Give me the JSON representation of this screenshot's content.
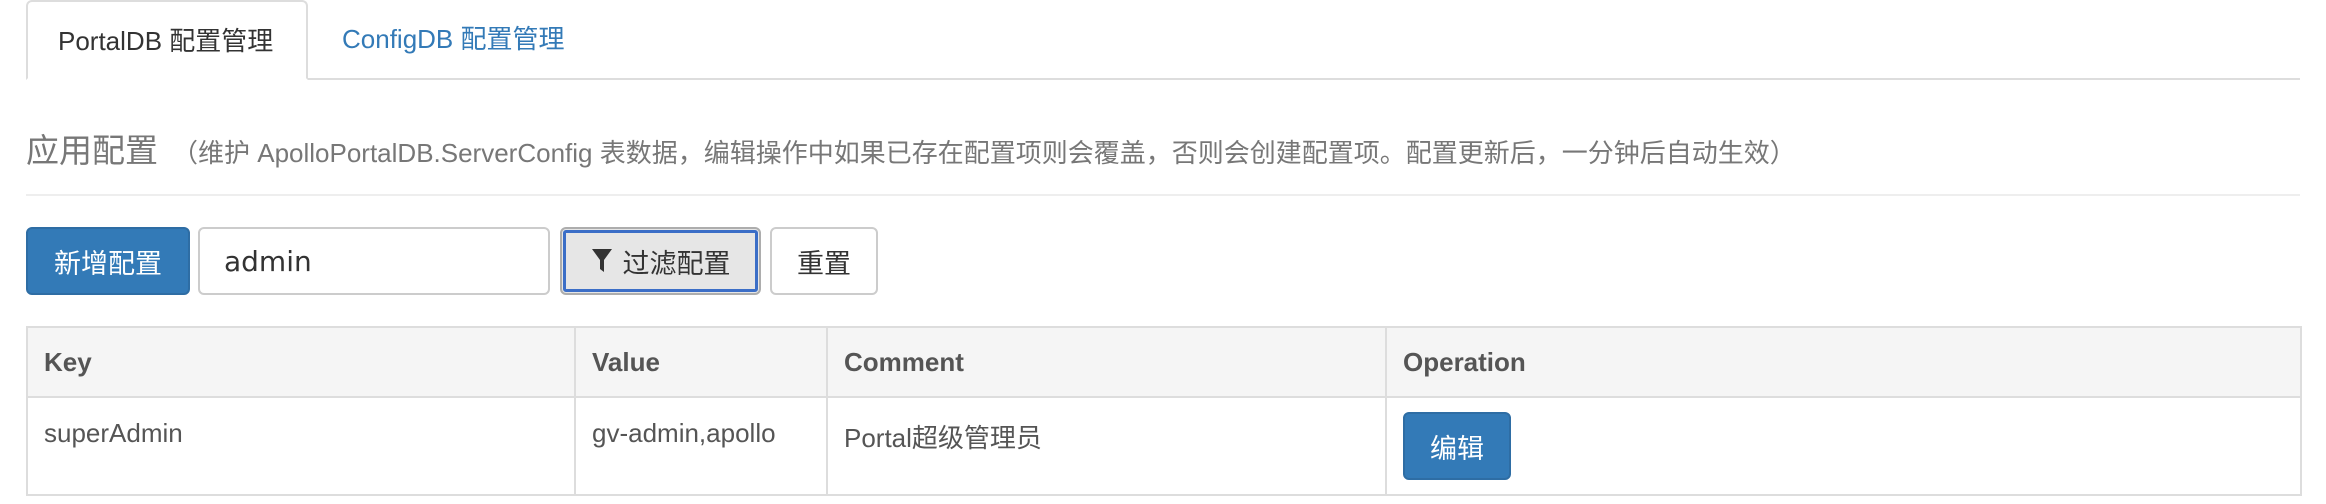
{
  "tabs": [
    {
      "label": "PortalDB 配置管理",
      "active": true
    },
    {
      "label": "ConfigDB 配置管理",
      "active": false
    }
  ],
  "section": {
    "title": "应用配置",
    "subtitle": "（维护 ApolloPortalDB.ServerConfig 表数据，编辑操作中如果已存在配置项则会覆盖，否则会创建配置项。配置更新后，一分钟后自动生效）"
  },
  "toolbar": {
    "add_label": "新增配置",
    "search_value": "admin",
    "filter_label": "过滤配置",
    "filter_icon": "filter-icon",
    "reset_label": "重置"
  },
  "table": {
    "columns": [
      "Key",
      "Value",
      "Comment",
      "Operation"
    ],
    "rows": [
      {
        "key": "superAdmin",
        "value": "gv-admin,apollo",
        "comment": "Portal超级管理员",
        "action": "编辑"
      }
    ]
  },
  "colors": {
    "primary": "#337ab7",
    "link": "#337ab7",
    "focus_outline": "#3b6ec7"
  }
}
